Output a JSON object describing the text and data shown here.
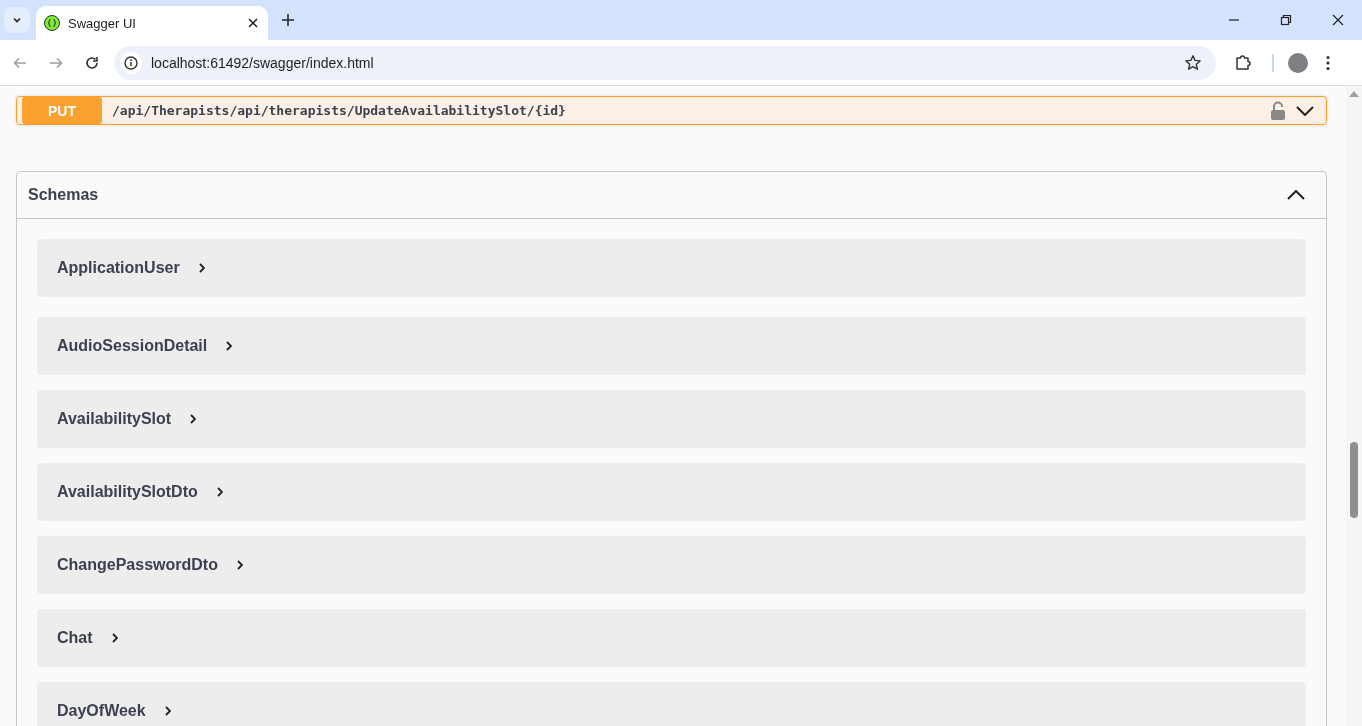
{
  "browser": {
    "tabs": [
      {
        "title": "Swagger UI",
        "selected": true
      }
    ],
    "address": "localhost:61492/swagger/index.html"
  },
  "operation": {
    "method": "PUT",
    "path": "/api/Therapists/api/therapists/UpdateAvailabilitySlot/{id}",
    "expanded": false
  },
  "schemas": {
    "title": "Schemas",
    "expanded": true,
    "items": [
      {
        "name": "ApplicationUser"
      },
      {
        "name": "AudioSessionDetail"
      },
      {
        "name": "AvailabilitySlot"
      },
      {
        "name": "AvailabilitySlotDto"
      },
      {
        "name": "ChangePasswordDto"
      },
      {
        "name": "Chat"
      },
      {
        "name": "DayOfWeek"
      }
    ]
  }
}
